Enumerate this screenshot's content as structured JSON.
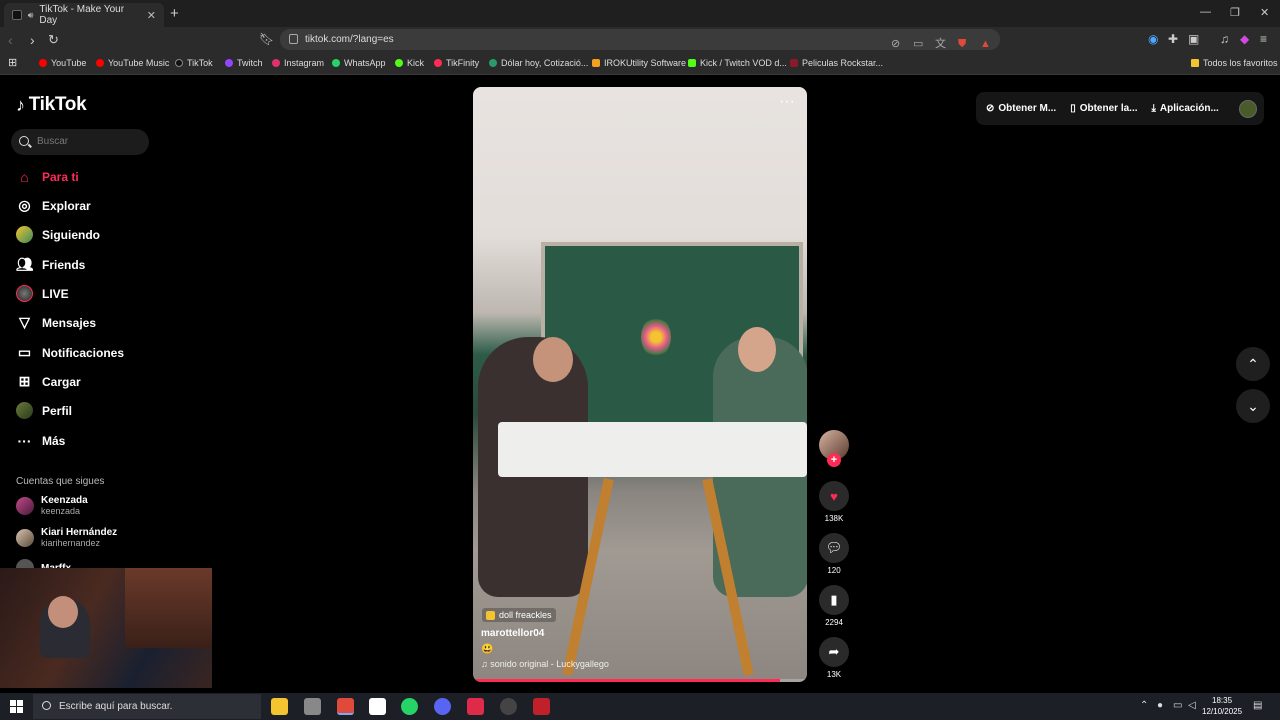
{
  "browser": {
    "tab_title": "TikTok - Make Your Day",
    "new_tab": "+",
    "url": "tiktok.com/?lang=es",
    "bookmarks": [
      "YouTube",
      "YouTube Music",
      "TikTok",
      "Twitch",
      "Instagram",
      "WhatsApp",
      "Kick",
      "TikFinity",
      "Dólar hoy, Cotizació...",
      "IROKUtility Software",
      "Kick / Twitch VOD d...",
      "Peliculas Rockstar..."
    ],
    "all_bookmarks": "Todos los favoritos"
  },
  "sidebar": {
    "logo": "TikTok",
    "search_placeholder": "Buscar",
    "nav": [
      {
        "label": "Para ti",
        "icon": "home-icon"
      },
      {
        "label": "Explorar",
        "icon": "compass-icon"
      },
      {
        "label": "Siguiendo",
        "icon": "following-avatar-icon"
      },
      {
        "label": "Friends",
        "icon": "friends-icon"
      },
      {
        "label": "LIVE",
        "icon": "live-icon"
      },
      {
        "label": "Mensajes",
        "icon": "send-icon"
      },
      {
        "label": "Notificaciones",
        "icon": "inbox-icon"
      },
      {
        "label": "Cargar",
        "icon": "upload-icon"
      },
      {
        "label": "Perfil",
        "icon": "profile-icon"
      },
      {
        "label": "Más",
        "icon": "more-icon"
      }
    ],
    "following_title": "Cuentas que sigues",
    "following": [
      {
        "name": "Keenzada",
        "handle": "keenzada"
      },
      {
        "name": "Kiari Hernández",
        "handle": "kiarihernandez"
      },
      {
        "name": "Marffx",
        "handle": ""
      }
    ]
  },
  "video": {
    "tag": "doll freackles",
    "username": "marottellor04",
    "emoji": "😃",
    "sound": "sonido original - Luckygallego",
    "progress": 0.92
  },
  "actions": {
    "likes": "138K",
    "comments": "120",
    "saves": "2294",
    "shares": "13K"
  },
  "topbar": {
    "coins": "Obtener M...",
    "app": "Obtener la...",
    "download": "Aplicación..."
  },
  "taskbar": {
    "search_placeholder": "Escribe aquí para buscar.",
    "time": "18:35",
    "date": "12/10/2025"
  },
  "colors": {
    "accent": "#fe2c55",
    "background": "#000000",
    "chrome": "#2b2b2b"
  }
}
